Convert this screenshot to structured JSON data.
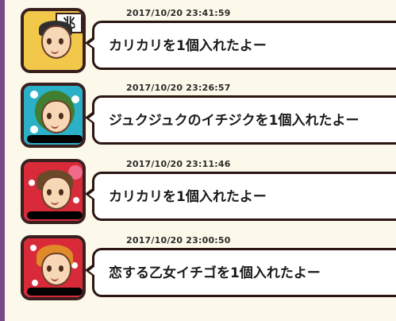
{
  "colors": {
    "panel_background": "#fdf9ea",
    "left_stripe": "#7a4a86",
    "bubble_border": "#2a1512",
    "bubble_fill": "#ffffff"
  },
  "messages": [
    {
      "timestamp": "2017/10/20 23:41:59",
      "text": "カリカリを1個入れたよー",
      "avatar_bg": "#f2c84b",
      "avatar_hair": "#2f2f2f",
      "avatar_badge": "兆"
    },
    {
      "timestamp": "2017/10/20 23:26:57",
      "text": "ジュクジュクのイチジクを1個入れたよー",
      "avatar_bg": "#2bb0c8",
      "avatar_hair": "#3f7f2f"
    },
    {
      "timestamp": "2017/10/20 23:11:46",
      "text": "カリカリを1個入れたよー",
      "avatar_bg": "#d92a3a",
      "avatar_hair": "#6b4a2a"
    },
    {
      "timestamp": "2017/10/20 23:00:50",
      "text": "恋する乙女イチゴを1個入れたよー",
      "avatar_bg": "#d92a3a",
      "avatar_hair": "#e08a2a"
    }
  ]
}
